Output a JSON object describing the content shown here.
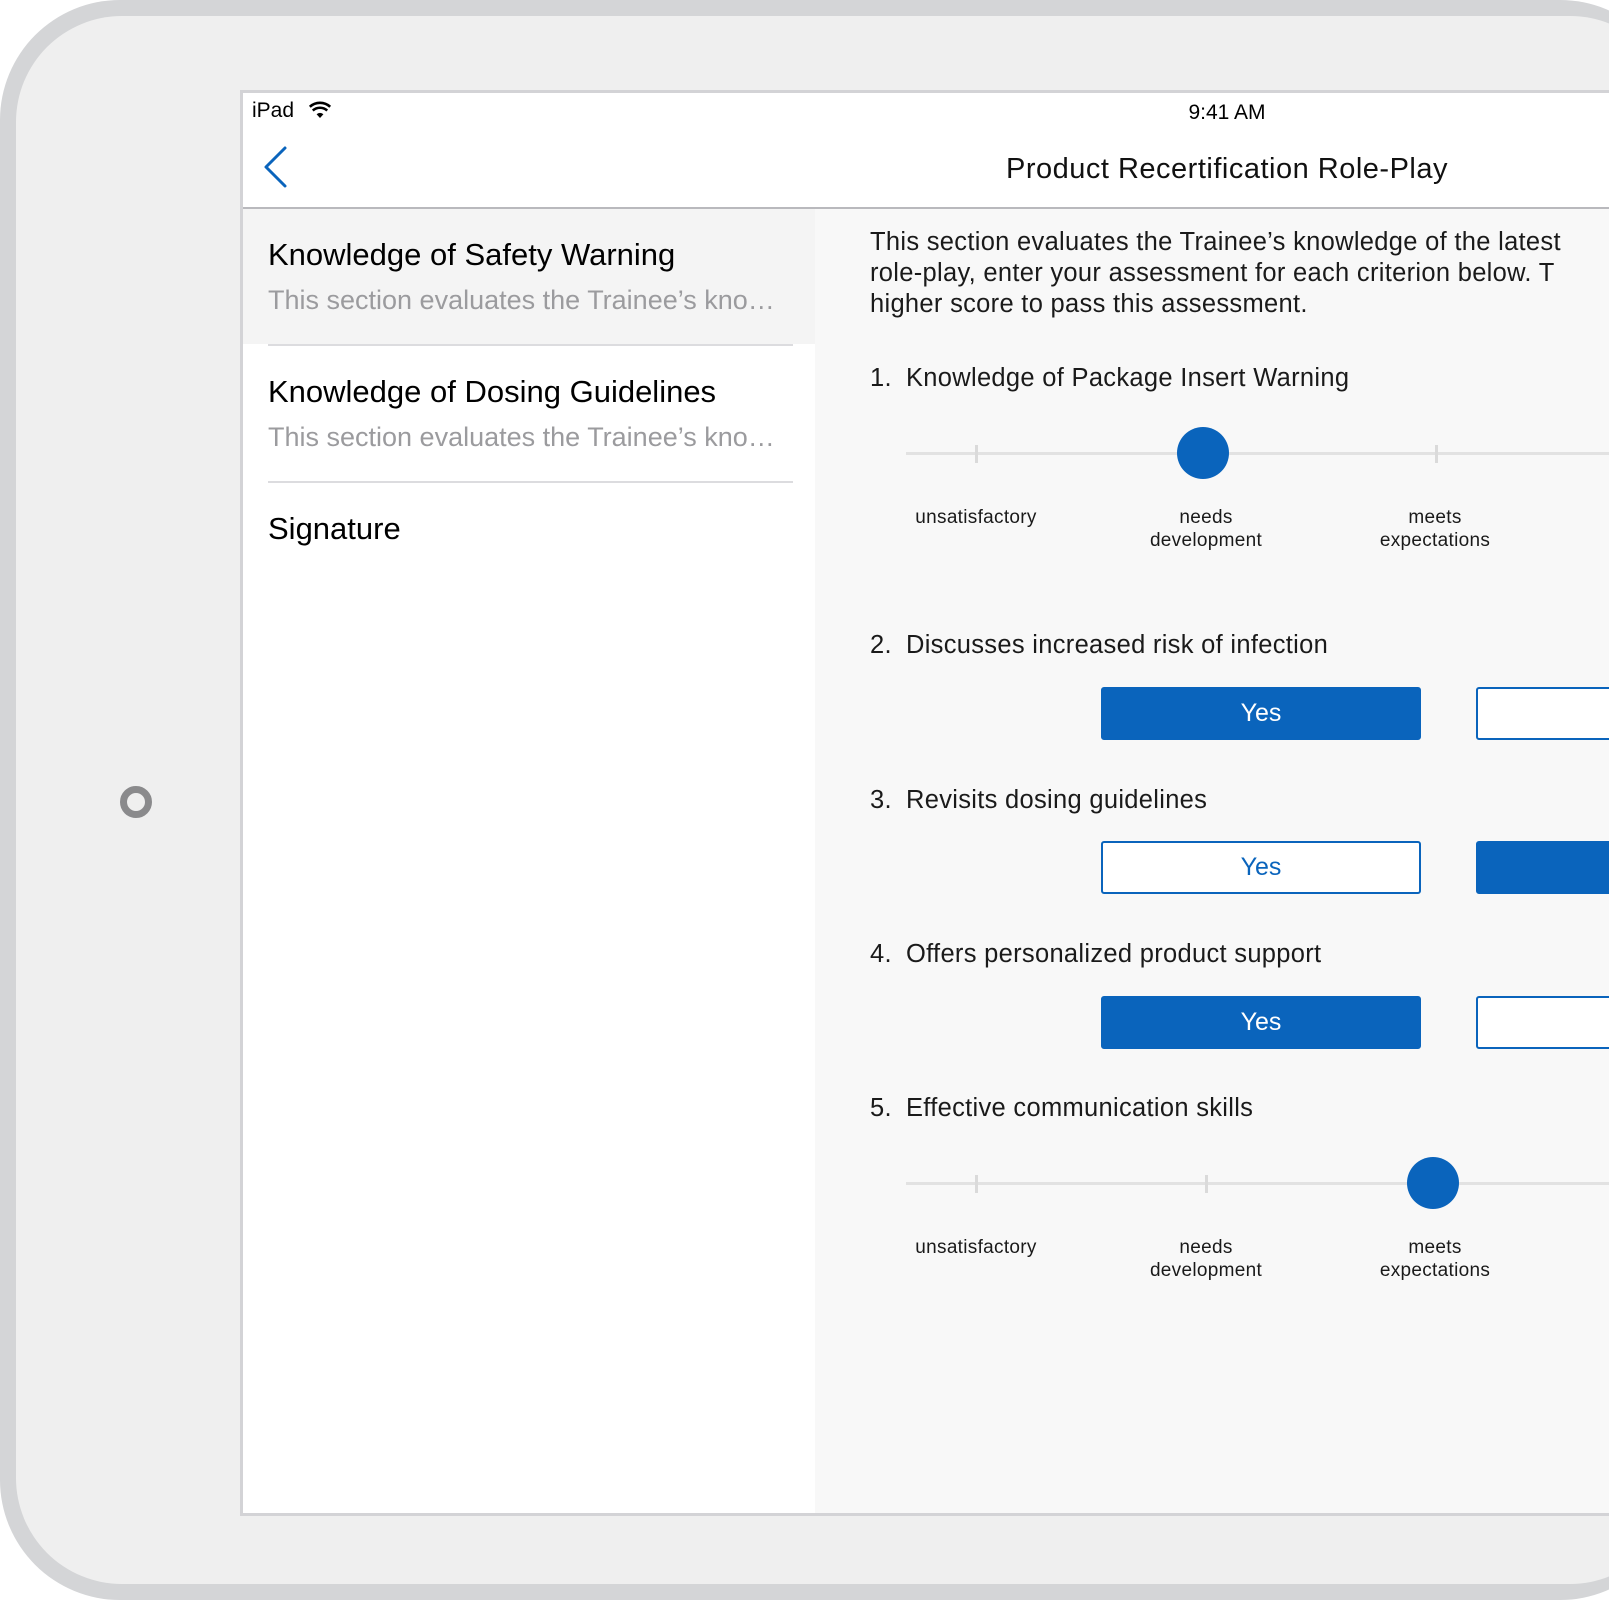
{
  "status_bar": {
    "carrier": "iPad",
    "time": "9:41 AM"
  },
  "nav": {
    "title": "Product Recertification Role-Play"
  },
  "sidebar": {
    "items": [
      {
        "title": "Knowledge of Safety Warning",
        "description": "This section evaluates the Trainee’s kno…",
        "selected": true
      },
      {
        "title": "Knowledge of Dosing Guidelines",
        "description": "This section evaluates the Trainee’s kno…",
        "selected": false
      },
      {
        "title": "Signature",
        "description": "",
        "selected": false
      }
    ]
  },
  "content": {
    "intro_lines": [
      "This section evaluates the Trainee’s knowledge of the latest",
      "role-play, enter your assessment for each criterion below.  T",
      "higher score to pass this assessment."
    ],
    "questions": [
      {
        "number": "1.",
        "text": "Knowledge of Package Insert Warning",
        "type": "slider",
        "labels": [
          [
            "unsatisfactory"
          ],
          [
            "needs",
            "development"
          ],
          [
            "meets",
            "expectations"
          ]
        ],
        "selected_index": 1
      },
      {
        "number": "2.",
        "text": "Discusses increased risk of infection",
        "type": "yes-no",
        "yes_label": "Yes",
        "selected": "yes"
      },
      {
        "number": "3.",
        "text": "Revisits dosing guidelines",
        "type": "yes-no",
        "yes_label": "Yes",
        "selected": "no"
      },
      {
        "number": "4.",
        "text": "Offers personalized product support",
        "type": "yes-no",
        "yes_label": "Yes",
        "selected": "yes"
      },
      {
        "number": "5.",
        "text": "Effective communication skills",
        "type": "slider",
        "labels": [
          [
            "unsatisfactory"
          ],
          [
            "needs",
            "development"
          ],
          [
            "meets",
            "expectations"
          ]
        ],
        "selected_index": 2
      }
    ]
  },
  "colors": {
    "accent": "#0a64bc",
    "divider": "#dcdcdf",
    "muted_text": "#9b9b9e"
  }
}
